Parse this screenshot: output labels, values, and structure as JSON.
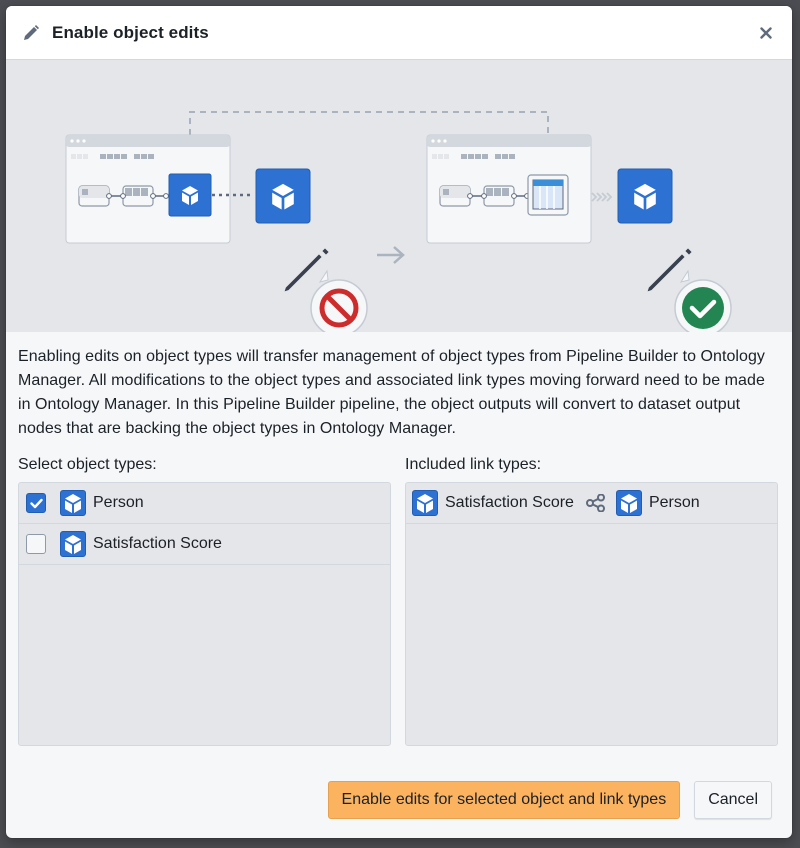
{
  "dialog": {
    "title": "Enable object edits",
    "title_icon": "pencil-icon",
    "close_icon": "close-icon"
  },
  "illustration": {
    "before_state": "blocked",
    "after_state": "allowed"
  },
  "description": "Enabling edits on object types will transfer management of object types from Pipeline Builder to Ontology Manager. All modifications to the object types and associated link types moving forward need to be made in Ontology Manager. In this Pipeline Builder pipeline, the object outputs will convert to dataset output nodes that are backing the object types in Ontology Manager.",
  "object_types": {
    "label": "Select object types:",
    "items": [
      {
        "name": "Person",
        "checked": true,
        "icon": "cube-icon"
      },
      {
        "name": "Satisfaction Score",
        "checked": false,
        "icon": "cube-icon"
      }
    ]
  },
  "link_types": {
    "label": "Included link types:",
    "items": [
      {
        "source": "Satisfaction Score",
        "target": "Person",
        "link_icon": "link-graph-icon"
      }
    ]
  },
  "footer": {
    "primary_label": "Enable edits for selected object and link types",
    "cancel_label": "Cancel"
  },
  "colors": {
    "accent": "#2d72d2",
    "primary_button": "#fbb360",
    "blocked": "#cd2c2c",
    "allowed": "#238551"
  }
}
